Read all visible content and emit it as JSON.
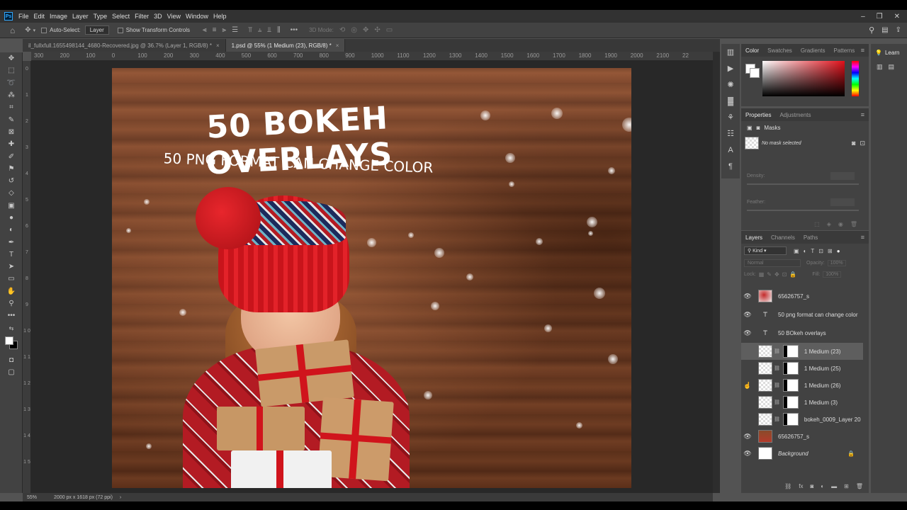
{
  "app": {
    "logo": "Ps"
  },
  "menu": [
    "File",
    "Edit",
    "Image",
    "Layer",
    "Type",
    "Select",
    "Filter",
    "3D",
    "View",
    "Window",
    "Help"
  ],
  "window_controls": {
    "minimize": "–",
    "maximize": "❐",
    "close": "✕"
  },
  "options_bar": {
    "auto_select_label": "Auto-Select:",
    "auto_select_target": "Layer",
    "show_transform_label": "Show Transform Controls",
    "three_d_mode_label": "3D Mode:"
  },
  "tabs": [
    {
      "label": "il_fullxfull.1655498144_4680-Recovered.jpg @ 36.7% (Layer 1, RGB/8) *",
      "close": "×"
    },
    {
      "label": "1.psd @ 55% (1 Medium (23), RGB/8) *",
      "close": "×"
    }
  ],
  "ruler_top": [
    "300",
    "200",
    "100",
    "0",
    "100",
    "200",
    "300",
    "400",
    "500",
    "600",
    "700",
    "800",
    "900",
    "1000",
    "1100",
    "1200",
    "1300",
    "1400",
    "1500",
    "1600",
    "1700",
    "1800",
    "1900",
    "2000",
    "2100",
    "22"
  ],
  "ruler_left": [
    "0",
    "1",
    "2",
    "3",
    "4",
    "5",
    "6",
    "7",
    "8",
    "9",
    "1 0",
    "1 1",
    "1 2",
    "1 3",
    "1 4",
    "1 5"
  ],
  "canvas_text": {
    "title": "50 BOKEH OVERLAYS",
    "subtitle": "50 PNG FORMAT CAN CHANGE COLOR"
  },
  "status": {
    "zoom": "55%",
    "doc_info": "2000 px x 1618 px (72 ppi)",
    "arrow": "›"
  },
  "color_panel": {
    "tabs": [
      "Color",
      "Swatches",
      "Gradients",
      "Patterns"
    ]
  },
  "properties_panel": {
    "tabs": [
      "Properties",
      "Adjustments"
    ],
    "section": "Masks",
    "no_mask": "No mask selected",
    "density_label": "Density:",
    "feather_label": "Feather:"
  },
  "layers_panel": {
    "tabs": [
      "Layers",
      "Channels",
      "Paths"
    ],
    "filter_kind": "Kind",
    "blend_mode": "Normal",
    "opacity_label": "Opacity:",
    "opacity_value": "100%",
    "lock_label": "Lock:",
    "fill_label": "Fill:",
    "fill_value": "100%",
    "layers": [
      {
        "name": "65626757_s",
        "visible": true,
        "kind": "image"
      },
      {
        "name": "50 png format can change color",
        "visible": true,
        "kind": "text"
      },
      {
        "name": "50 BOkeh overlays",
        "visible": true,
        "kind": "text"
      },
      {
        "name": "1 Medium (23)",
        "visible": false,
        "kind": "masked",
        "selected": true
      },
      {
        "name": "1 Medium (25)",
        "visible": false,
        "kind": "masked"
      },
      {
        "name": "1 Medium (26)",
        "visible": false,
        "kind": "masked"
      },
      {
        "name": "1 Medium (3)",
        "visible": false,
        "kind": "masked"
      },
      {
        "name": "bokeh_0009_Layer 20",
        "visible": false,
        "kind": "masked"
      },
      {
        "name": "65626757_s",
        "visible": true,
        "kind": "photo"
      },
      {
        "name": "Background",
        "visible": true,
        "kind": "background"
      }
    ]
  },
  "learn": {
    "label": "Learn"
  },
  "colors": {
    "ui_dark": "#323232",
    "panel": "#424242",
    "accent_red": "#d0141c"
  }
}
